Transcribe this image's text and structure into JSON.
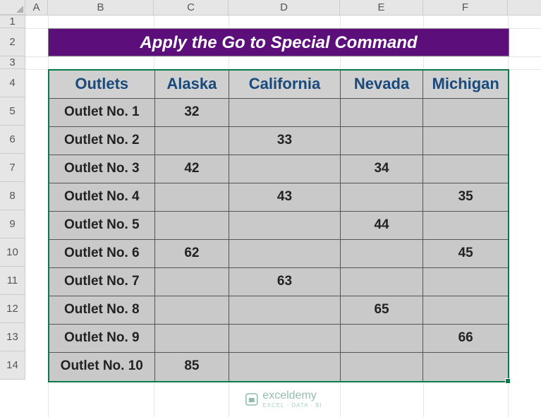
{
  "columns": [
    "A",
    "B",
    "C",
    "D",
    "E",
    "F"
  ],
  "rows": [
    "1",
    "2",
    "3",
    "4",
    "5",
    "6",
    "7",
    "8",
    "9",
    "10",
    "11",
    "12",
    "13",
    "14"
  ],
  "title": "Apply the Go to Special Command",
  "headers": {
    "outlets": "Outlets",
    "alaska": "Alaska",
    "california": "California",
    "nevada": "Nevada",
    "michigan": "Michigan"
  },
  "data": [
    {
      "outlet": "Outlet No. 1",
      "alaska": "32",
      "california": "",
      "nevada": "",
      "michigan": ""
    },
    {
      "outlet": "Outlet No. 2",
      "alaska": "",
      "california": "33",
      "nevada": "",
      "michigan": ""
    },
    {
      "outlet": "Outlet No. 3",
      "alaska": "42",
      "california": "",
      "nevada": "34",
      "michigan": ""
    },
    {
      "outlet": "Outlet No. 4",
      "alaska": "",
      "california": "43",
      "nevada": "",
      "michigan": "35"
    },
    {
      "outlet": "Outlet No. 5",
      "alaska": "",
      "california": "",
      "nevada": "44",
      "michigan": ""
    },
    {
      "outlet": "Outlet No. 6",
      "alaska": "62",
      "california": "",
      "nevada": "",
      "michigan": "45"
    },
    {
      "outlet": "Outlet No. 7",
      "alaska": "",
      "california": "63",
      "nevada": "",
      "michigan": ""
    },
    {
      "outlet": "Outlet No. 8",
      "alaska": "",
      "california": "",
      "nevada": "65",
      "michigan": ""
    },
    {
      "outlet": "Outlet No. 9",
      "alaska": "",
      "california": "",
      "nevada": "",
      "michigan": "66"
    },
    {
      "outlet": "Outlet No. 10",
      "alaska": "85",
      "california": "",
      "nevada": "",
      "michigan": ""
    }
  ],
  "watermark": {
    "brand": "exceldemy",
    "tag": "EXCEL · DATA · BI"
  },
  "chart_data": {
    "type": "table",
    "title": "Apply the Go to Special Command",
    "columns": [
      "Outlets",
      "Alaska",
      "California",
      "Nevada",
      "Michigan"
    ],
    "rows": [
      [
        "Outlet No. 1",
        32,
        null,
        null,
        null
      ],
      [
        "Outlet No. 2",
        null,
        33,
        null,
        null
      ],
      [
        "Outlet No. 3",
        42,
        null,
        34,
        null
      ],
      [
        "Outlet No. 4",
        null,
        43,
        null,
        35
      ],
      [
        "Outlet No. 5",
        null,
        null,
        44,
        null
      ],
      [
        "Outlet No. 6",
        62,
        null,
        null,
        45
      ],
      [
        "Outlet No. 7",
        null,
        63,
        null,
        null
      ],
      [
        "Outlet No. 8",
        null,
        null,
        65,
        null
      ],
      [
        "Outlet No. 9",
        null,
        null,
        null,
        66
      ],
      [
        "Outlet No. 10",
        85,
        null,
        null,
        null
      ]
    ]
  }
}
